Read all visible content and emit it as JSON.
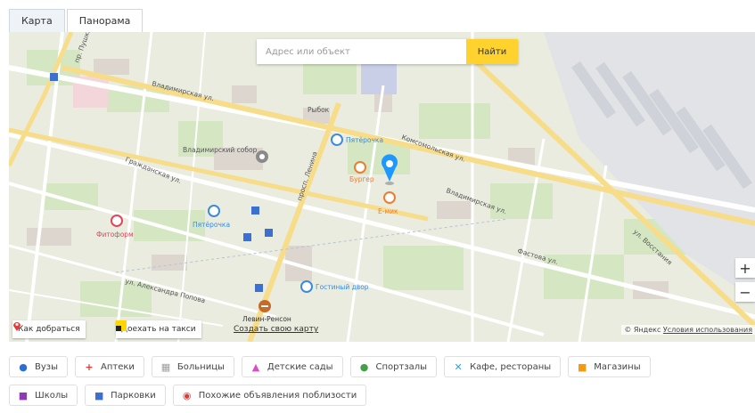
{
  "tabs": [
    "Карта",
    "Панорама"
  ],
  "search": {
    "placeholder": "Адрес или объект",
    "button": "Найти"
  },
  "streets": {
    "vladimirskaya": "Владимирская ул.",
    "grazhdanskaya": "Гражданская ул.",
    "fastova": "Фастова ул.",
    "vostaniya": "ул. Восстания",
    "lenina": "просп. Ленина",
    "pushkina": "пр. Пушкина",
    "aleksandra": "ул. Александра Попова",
    "komsomolskaya": "Комсомольская ул."
  },
  "map_labels": {
    "ryabok": "Рыбок",
    "square": "Владимирский собор"
  },
  "pois": {
    "pyaterochka1": "Пятёрочка",
    "pyaterochka2": "Пятёрочка",
    "burger": "Бургер",
    "eshop": "E-мик",
    "dental": "Фитоформ",
    "hostel": "Гостиный двор",
    "metro": "Левин-Ренсон"
  },
  "map_controls": {
    "zoom_in": "+",
    "zoom_out": "−",
    "route": "Как добраться",
    "taxi": "Доехать на такси",
    "create_map": "Создать свою карту",
    "copyright": "© Яндекс",
    "terms": "Условия использования"
  },
  "filters": {
    "row1": [
      "Вузы",
      "Аптеки",
      "Больницы",
      "Детские сады",
      "Спортзалы",
      "Кафе, рестораны",
      "Магазины"
    ],
    "row2": [
      "Школы",
      "Парковки",
      "Похожие объявления поблизости"
    ]
  },
  "colors": {
    "pin": "#1e98ff",
    "route_icon": "#e53935",
    "taxi_icon": "#ffd600",
    "search_button": "#ffd22e"
  }
}
